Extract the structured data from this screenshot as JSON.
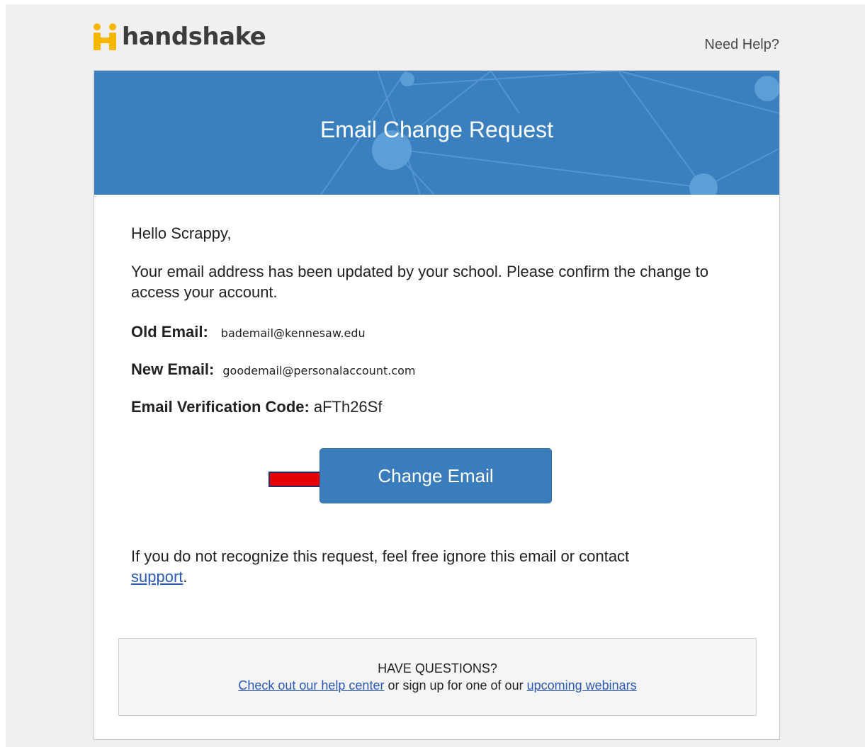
{
  "header": {
    "logo_text": "handshake",
    "need_help": "Need Help?"
  },
  "banner": {
    "title": "Email Change Request"
  },
  "body": {
    "greeting": "Hello Scrappy,",
    "intro": "Your email address has been updated by your school. Please confirm the change to access your account.",
    "old_email_label": "Old Email:",
    "old_email_value": "bademail@kennesaw.edu",
    "new_email_label": "New Email:",
    "new_email_value": "goodemail@personalaccount.com",
    "code_label": "Email Verification Code:",
    "code_value": "aFTh26Sf"
  },
  "action": {
    "button_label": "Change Email"
  },
  "notice": {
    "text": "If you do not recognize this request, feel free ignore this email or contact",
    "link": "support",
    "end": "."
  },
  "questions": {
    "heading": "HAVE QUESTIONS?",
    "help_link": "Check out our help center",
    "middle": " or sign up for one of our ",
    "webinar_link": "upcoming webinars"
  },
  "colors": {
    "banner": "#3a80bf",
    "button": "#3a7dbd",
    "arrow": "#e60000",
    "logo": "#f5b700",
    "link": "#2a5ab3"
  }
}
